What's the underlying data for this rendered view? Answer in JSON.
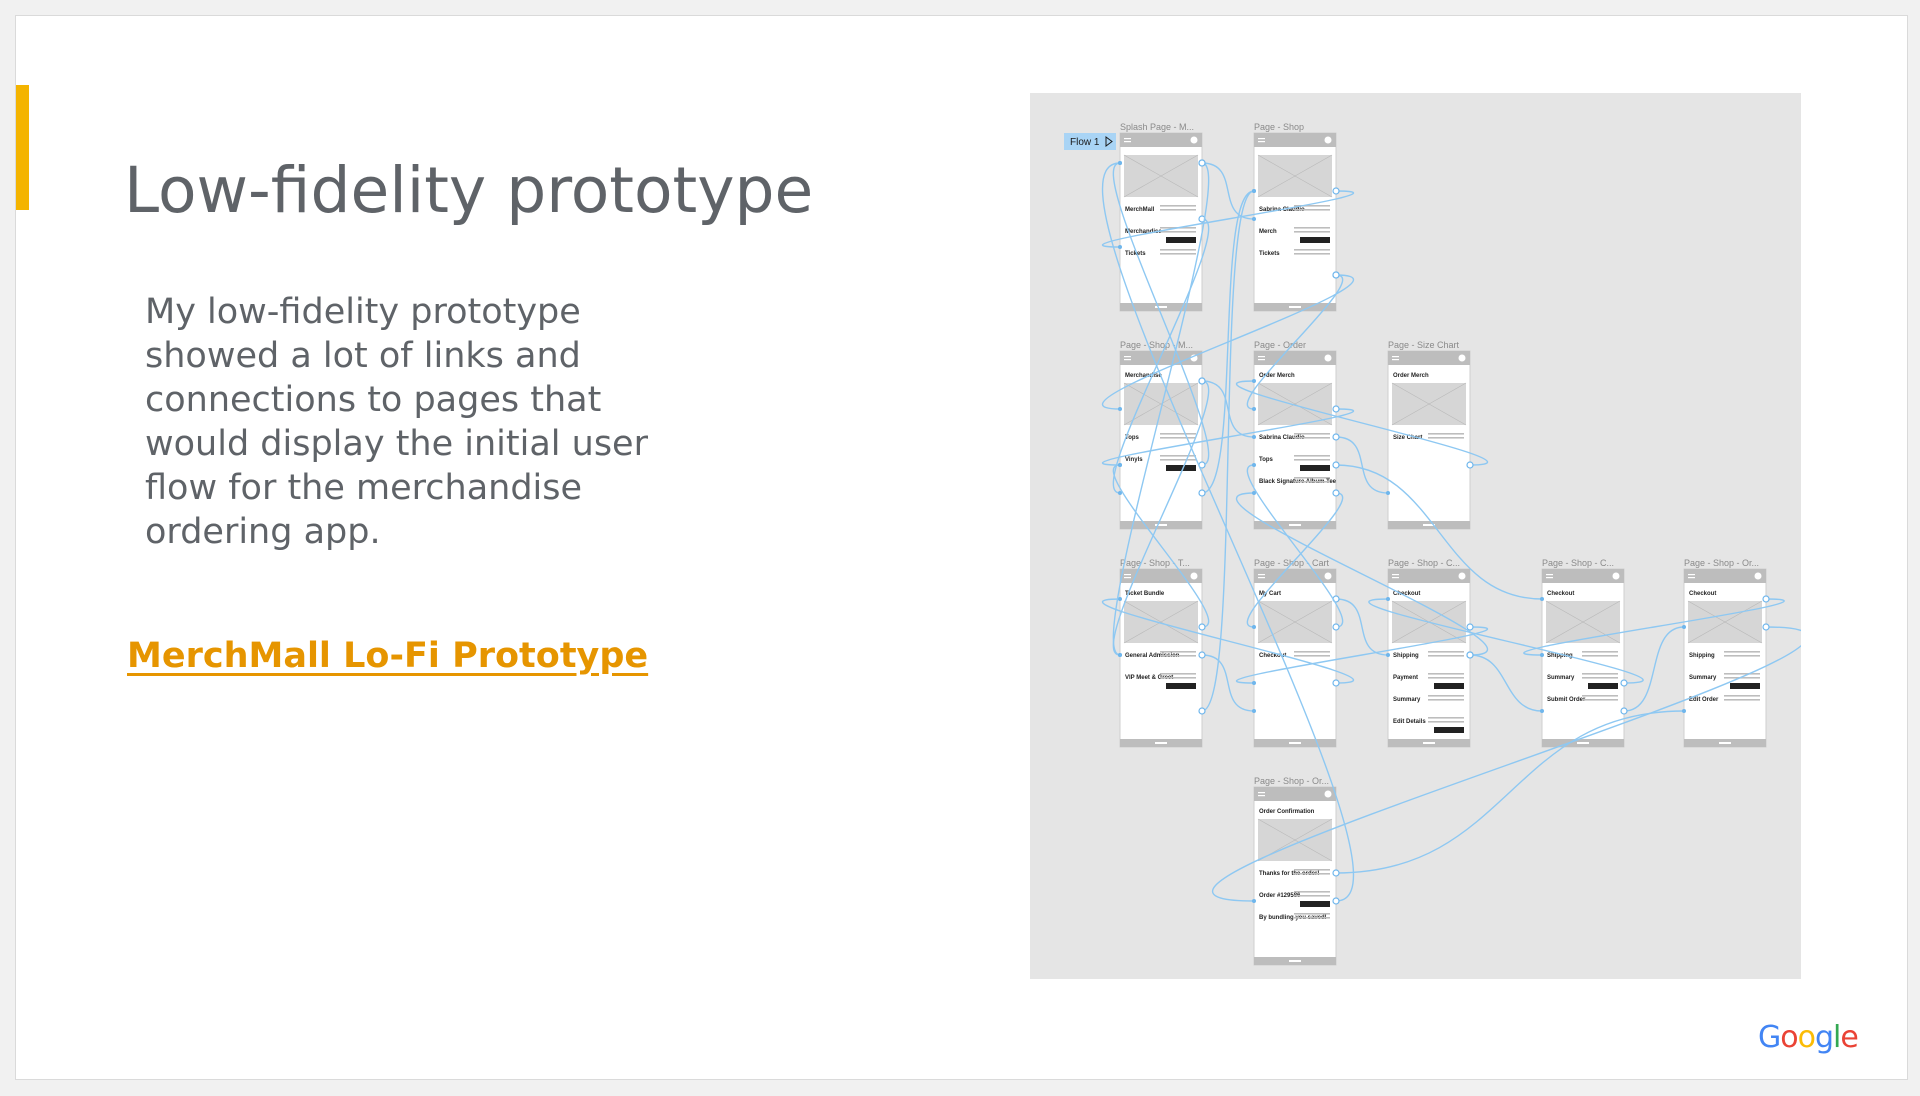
{
  "slide": {
    "title": "Low-fidelity prototype",
    "body": "My low-fidelity prototype showed a lot of links and connections to pages that would display the initial user flow for the merchandise ordering app.",
    "link_text": "MerchMall Lo-Fi Prototype",
    "accent_color": "#f4b400",
    "link_color": "#e69500",
    "text_color": "#5f6368"
  },
  "prototype": {
    "flow_label": "Flow 1",
    "frames": [
      {
        "label": "Splash Page - M...",
        "heading": "",
        "texts": [
          "MerchMall",
          "Merchandise",
          "Tickets"
        ]
      },
      {
        "label": "Page - Shop",
        "heading": "",
        "texts": [
          "Sabrina Claudio",
          "Merch",
          "Tickets"
        ]
      },
      {
        "label": "Page - Shop - M...",
        "heading": "Merchandise",
        "texts": [
          "Tops",
          "Vinyls"
        ]
      },
      {
        "label": "Page - Order",
        "heading": "Order Merch",
        "texts": [
          "Sabrina Claudio",
          "Tops",
          "Black Signature Album Tee"
        ]
      },
      {
        "label": "Page - Size Chart",
        "heading": "Order Merch",
        "texts": [
          "Size Chart"
        ]
      },
      {
        "label": "Page - Shop - T...",
        "heading": "Ticket Bundle",
        "texts": [
          "General Admission",
          "VIP Meet & Greet"
        ]
      },
      {
        "label": "Page - Shop - Cart",
        "heading": "My Cart",
        "texts": [
          "Checkout"
        ]
      },
      {
        "label": "Page - Shop - C...",
        "heading": "Checkout",
        "texts": [
          "Shipping",
          "Payment",
          "Summary",
          "Edit Details"
        ]
      },
      {
        "label": "Page - Shop - C...",
        "heading": "Checkout",
        "texts": [
          "Shipping",
          "Summary",
          "Submit Order"
        ]
      },
      {
        "label": "Page - Shop - Or...",
        "heading": "Checkout",
        "texts": [
          "Shipping",
          "Summary",
          "Edit Order"
        ]
      },
      {
        "label": "Page - Shop - Or...",
        "heading": "Order Confirmation",
        "texts": [
          "Thanks for the order!",
          "Order #129586",
          "By bundling you saved!"
        ]
      }
    ]
  },
  "brand": {
    "logo_letters": [
      "G",
      "o",
      "o",
      "g",
      "l",
      "e"
    ],
    "logo_colors": [
      "#4285f4",
      "#ea4335",
      "#fbbc05",
      "#4285f4",
      "#34a853",
      "#ea4335"
    ]
  }
}
